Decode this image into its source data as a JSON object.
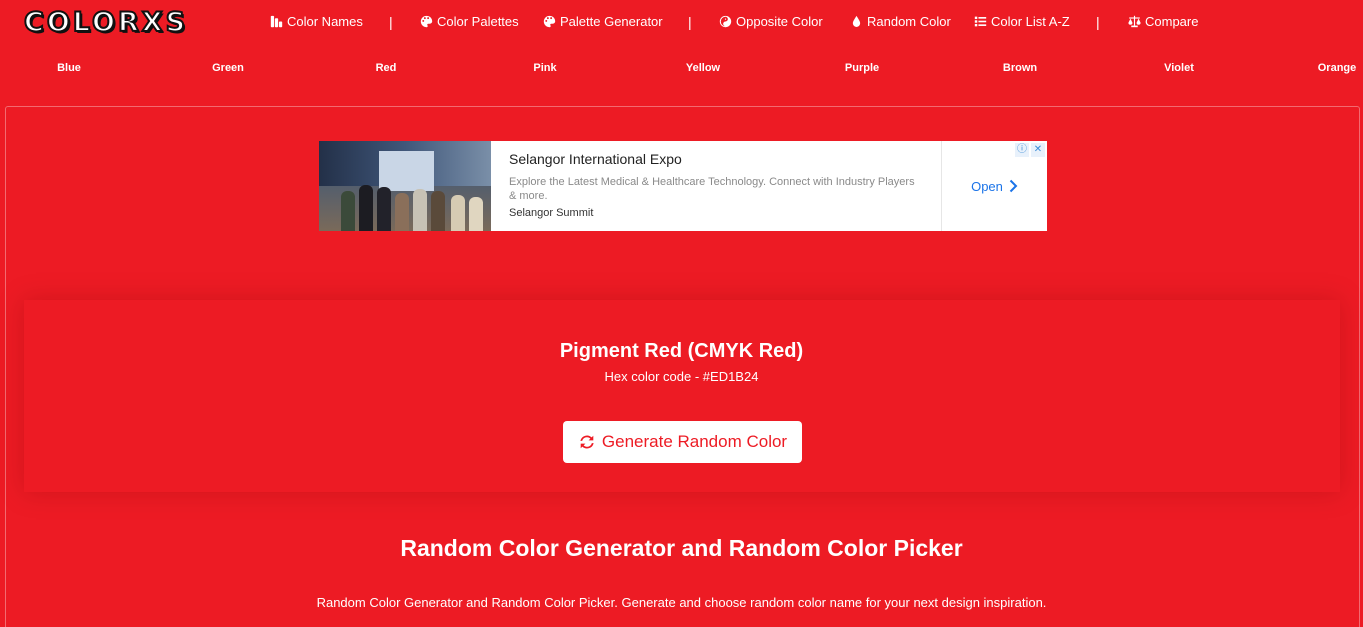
{
  "logo": {
    "text": "COLORXS"
  },
  "topnav": {
    "items": [
      {
        "label": "Color Names",
        "icon": "palette-swatch-icon"
      },
      {
        "label": "Color Palettes",
        "icon": "palette-icon"
      },
      {
        "label": "Palette Generator",
        "icon": "palette-icon"
      },
      {
        "label": "Opposite Color",
        "icon": "yin-yang-icon"
      },
      {
        "label": "Random Color",
        "icon": "droplet-icon"
      },
      {
        "label": "Color List A-Z",
        "icon": "list-icon"
      },
      {
        "label": "Compare",
        "icon": "balance-scale-icon"
      }
    ],
    "separator": "|"
  },
  "colornav": {
    "items": [
      "Blue",
      "Green",
      "Red",
      "Pink",
      "Yellow",
      "Purple",
      "Brown",
      "Violet",
      "Orange"
    ]
  },
  "ad": {
    "title": "Selangor International Expo",
    "description": "Explore the Latest Medical & Healthcare Technology. Connect with Industry Players & more.",
    "brand": "Selangor Summit",
    "cta": "Open",
    "cta_icon": "chevron-right-icon",
    "info_icon": "ⓘ",
    "close_icon": "✕"
  },
  "color": {
    "name": "Pigment Red (CMYK Red)",
    "hex_line": "Hex color code - #ED1B24",
    "hex": "#ED1B24"
  },
  "generate_button": {
    "label": "Generate Random Color",
    "icon": "refresh-icon"
  },
  "content": {
    "heading": "Random Color Generator and Random Color Picker",
    "description": "Random Color Generator and Random Color Picker. Generate and choose random color name for your next design inspiration."
  }
}
